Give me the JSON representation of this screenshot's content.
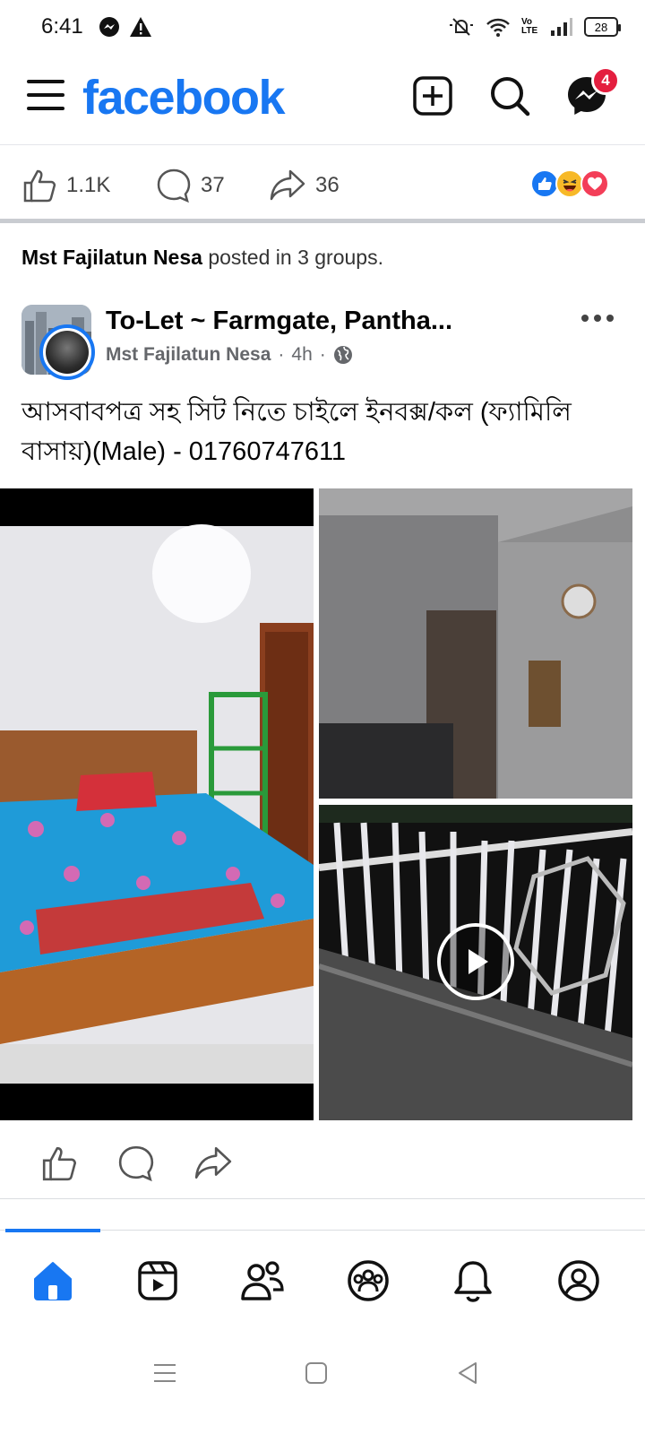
{
  "status_bar": {
    "time": "6:41",
    "battery": "28",
    "network": "Vo LTE"
  },
  "header": {
    "logo": "facebook",
    "messenger_badge": "4",
    "brand_color": "#1877f2"
  },
  "stats": {
    "likes": "1.1K",
    "comments": "37",
    "shares": "36",
    "reactions": [
      "like",
      "haha",
      "love"
    ]
  },
  "shared": {
    "author": "Mst Fajilatun Nesa",
    "text": " posted in 3 groups."
  },
  "post": {
    "group": "To-Let ~ Farmgate, Pantha...",
    "author": "Mst Fajilatun Nesa",
    "time": "4h",
    "separator": "·",
    "text": "আসবাবপত্র সহ সিট নিতে চাইলে ইনবক্স/কল (ফ্যামিলি বাসায়)(Male) - 01760747611"
  },
  "icons": {
    "menu": "menu-icon",
    "create": "plus-square-icon",
    "search": "search-icon",
    "messenger": "messenger-icon",
    "like": "thumbs-up-icon",
    "comment": "comment-icon",
    "share": "share-icon",
    "globe": "globe-icon",
    "more": "more-dots-icon",
    "play": "play-icon"
  },
  "bottom_nav": [
    "home",
    "video",
    "friends",
    "groups",
    "notifications",
    "profile"
  ]
}
